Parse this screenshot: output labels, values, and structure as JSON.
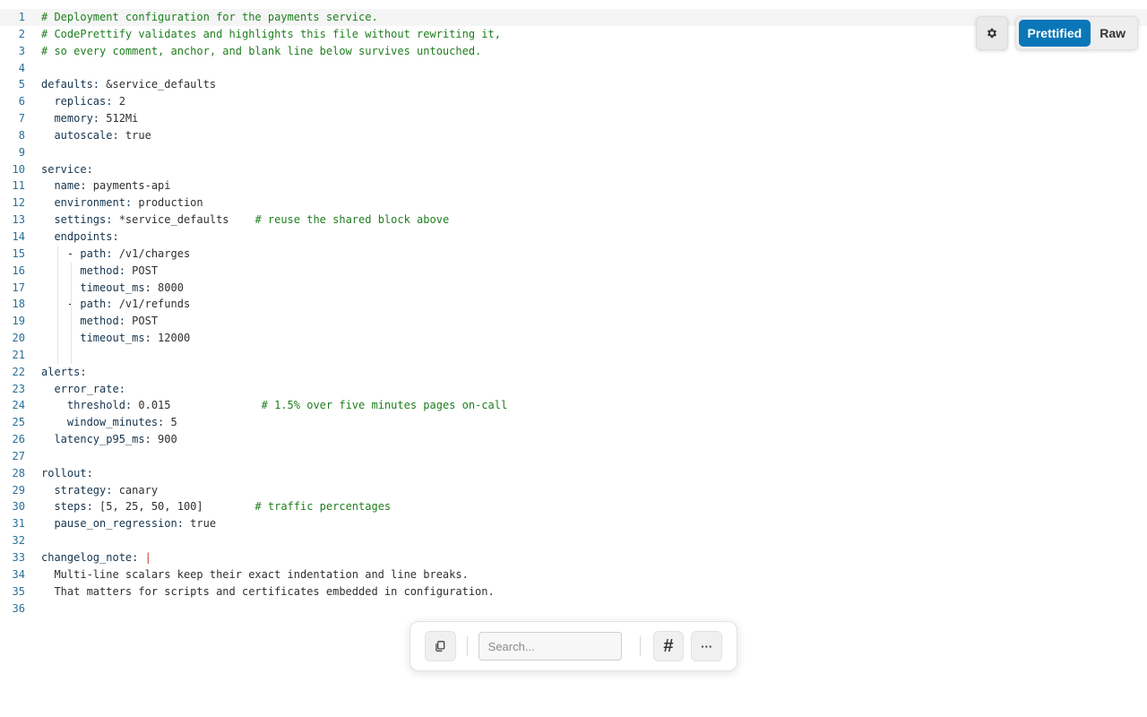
{
  "view_modes": {
    "prettified_label": "Prettified",
    "raw_label": "Raw",
    "active": "prettified"
  },
  "icons": {
    "settings": "gear-icon",
    "copy": "copy-icon",
    "line_numbers": "hash-icon",
    "more": "ellipsis-icon"
  },
  "toolbar": {
    "search_placeholder": "Search...",
    "line_numbers_label": "#",
    "more_label": "···"
  },
  "colors": {
    "accent": "#0b76b8",
    "line_number": "#2a6f97",
    "comment": "#1e7e1e",
    "block_indicator": "#c0392b"
  },
  "code_lines": [
    {
      "n": "1",
      "k": "",
      "v": "",
      "c": "# Deployment configuration for the payments service."
    },
    {
      "n": "2",
      "k": "",
      "v": "",
      "c": "# CodePrettify validates and highlights this file without rewriting it,"
    },
    {
      "n": "3",
      "k": "",
      "v": "",
      "c": "# so every comment, anchor, and blank line below survives untouched."
    },
    {
      "n": "4",
      "k": "",
      "v": "",
      "c": ""
    },
    {
      "n": "5",
      "k": "defaults:",
      "v": " &service_defaults",
      "c": ""
    },
    {
      "n": "6",
      "k": "  replicas:",
      "v": " 2",
      "c": ""
    },
    {
      "n": "7",
      "k": "  memory:",
      "v": " 512Mi",
      "c": ""
    },
    {
      "n": "8",
      "k": "  autoscale:",
      "v": " true",
      "c": ""
    },
    {
      "n": "9",
      "k": "",
      "v": "",
      "c": ""
    },
    {
      "n": "10",
      "k": "service:",
      "v": "",
      "c": ""
    },
    {
      "n": "11",
      "k": "  name:",
      "v": " payments-api",
      "c": ""
    },
    {
      "n": "12",
      "k": "  environment:",
      "v": " production",
      "c": ""
    },
    {
      "n": "13",
      "k": "  settings:",
      "v": " *service_defaults    ",
      "c": "# reuse the shared block above"
    },
    {
      "n": "14",
      "k": "  endpoints:",
      "v": "",
      "c": ""
    },
    {
      "n": "15",
      "k": "    - path:",
      "v": " /v1/charges",
      "c": ""
    },
    {
      "n": "16",
      "k": "      method:",
      "v": " POST",
      "c": ""
    },
    {
      "n": "17",
      "k": "      timeout_ms:",
      "v": " 8000",
      "c": ""
    },
    {
      "n": "18",
      "k": "    - path:",
      "v": " /v1/refunds",
      "c": ""
    },
    {
      "n": "19",
      "k": "      method:",
      "v": " POST",
      "c": ""
    },
    {
      "n": "20",
      "k": "      timeout_ms:",
      "v": " 12000",
      "c": ""
    },
    {
      "n": "21",
      "k": "",
      "v": "",
      "c": ""
    },
    {
      "n": "22",
      "k": "alerts:",
      "v": "",
      "c": ""
    },
    {
      "n": "23",
      "k": "  error_rate:",
      "v": "",
      "c": ""
    },
    {
      "n": "24",
      "k": "    threshold:",
      "v": " 0.015              ",
      "c": "# 1.5% over five minutes pages on-call"
    },
    {
      "n": "25",
      "k": "    window_minutes:",
      "v": " 5",
      "c": ""
    },
    {
      "n": "26",
      "k": "  latency_p95_ms:",
      "v": " 900",
      "c": ""
    },
    {
      "n": "27",
      "k": "",
      "v": "",
      "c": ""
    },
    {
      "n": "28",
      "k": "rollout:",
      "v": "",
      "c": ""
    },
    {
      "n": "29",
      "k": "  strategy:",
      "v": " canary",
      "c": ""
    },
    {
      "n": "30",
      "k": "  steps:",
      "v": " [5, 25, 50, 100]        ",
      "c": "# traffic percentages"
    },
    {
      "n": "31",
      "k": "  pause_on_regression:",
      "v": " true",
      "c": ""
    },
    {
      "n": "32",
      "k": "",
      "v": "",
      "c": ""
    },
    {
      "n": "33",
      "k": "changelog_note:",
      "v": " ",
      "c": "",
      "p": "|"
    },
    {
      "n": "34",
      "k": "",
      "v": "  Multi-line scalars keep their exact indentation and line breaks.",
      "c": ""
    },
    {
      "n": "35",
      "k": "",
      "v": "  That matters for scripts and certificates embedded in configuration.",
      "c": ""
    },
    {
      "n": "36",
      "k": "",
      "v": "",
      "c": ""
    }
  ]
}
